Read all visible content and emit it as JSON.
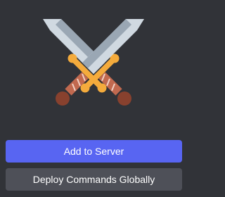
{
  "emoji": {
    "icon": "crossed-swords-icon"
  },
  "actions": {
    "add_to_server_label": "Add to Server",
    "deploy_globally_label": "Deploy Commands Globally"
  },
  "colors": {
    "background": "#313338",
    "primary_button": "#5865f2",
    "secondary_button": "#4e5058",
    "blade_light": "#d0d9e1",
    "blade_dark": "#9aa7b4",
    "guard": "#f4ab3c",
    "grip": "#c1694f",
    "pommel": "#88412e"
  }
}
